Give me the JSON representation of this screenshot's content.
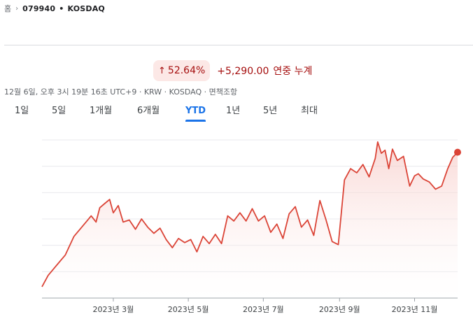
{
  "breadcrumb": {
    "home": "홈",
    "separator": "›",
    "symbol": "079940",
    "dot": "•",
    "exchange": "KOSDAQ"
  },
  "change": {
    "arrow": "↑",
    "percent": "52.64%",
    "absolute": "+5,290.00",
    "period": "연중 누계"
  },
  "meta": {
    "text": "12월 6일, 오후 3시 19분 16초 UTC+9 · KRW · KOSDAQ · 면책조항"
  },
  "tabs": [
    {
      "label": "1일",
      "active": false
    },
    {
      "label": "5일",
      "active": false
    },
    {
      "label": "1개월",
      "active": false
    },
    {
      "label": "6개월",
      "active": false
    },
    {
      "label": "YTD",
      "active": true
    },
    {
      "label": "1년",
      "active": false
    },
    {
      "label": "5년",
      "active": false
    },
    {
      "label": "최대",
      "active": false
    }
  ],
  "colors": {
    "line": "#db4437",
    "fill_top": "#f6c3bf",
    "grid": "#e8eaed",
    "accent": "#1a73e8",
    "up": "#a50e0e"
  },
  "chart_data": {
    "type": "area",
    "xlabel": "",
    "ylabel": "",
    "x_tick_labels": [
      "2023년 3월",
      "2023년 5월",
      "2023년 7월",
      "2023년 9월",
      "2023년 11월"
    ],
    "x_tick_dates": [
      "2023-03-01",
      "2023-05-01",
      "2023-07-01",
      "2023-09-01",
      "2023-11-01"
    ],
    "x_range": [
      "2023-01-02",
      "2023-12-06"
    ],
    "y_range": [
      9500,
      17200
    ],
    "y_gridlines": 6,
    "grid": true,
    "end_marker": true,
    "series": [
      {
        "x": [
          "2023-01-02",
          "2023-01-07",
          "2023-01-14",
          "2023-01-21",
          "2023-01-28",
          "2023-02-04",
          "2023-02-11",
          "2023-02-15",
          "2023-02-18",
          "2023-02-22",
          "2023-02-26",
          "2023-03-01",
          "2023-03-05",
          "2023-03-09",
          "2023-03-14",
          "2023-03-19",
          "2023-03-24",
          "2023-03-29",
          "2023-04-03",
          "2023-04-08",
          "2023-04-13",
          "2023-04-18",
          "2023-04-23",
          "2023-04-28",
          "2023-05-03",
          "2023-05-08",
          "2023-05-13",
          "2023-05-18",
          "2023-05-23",
          "2023-05-28",
          "2023-06-02",
          "2023-06-07",
          "2023-06-12",
          "2023-06-17",
          "2023-06-22",
          "2023-06-27",
          "2023-07-02",
          "2023-07-07",
          "2023-07-12",
          "2023-07-17",
          "2023-07-22",
          "2023-07-27",
          "2023-08-01",
          "2023-08-06",
          "2023-08-11",
          "2023-08-16",
          "2023-08-21",
          "2023-08-26",
          "2023-08-31",
          "2023-09-05",
          "2023-09-10",
          "2023-09-15",
          "2023-09-20",
          "2023-09-25",
          "2023-09-30",
          "2023-10-02",
          "2023-10-05",
          "2023-10-08",
          "2023-10-11",
          "2023-10-14",
          "2023-10-18",
          "2023-10-23",
          "2023-10-28",
          "2023-11-01",
          "2023-11-04",
          "2023-11-08",
          "2023-11-13",
          "2023-11-18",
          "2023-11-23",
          "2023-11-28",
          "2023-12-02",
          "2023-12-06"
        ],
        "y": [
          10050,
          10600,
          11100,
          11600,
          12500,
          13000,
          13500,
          13200,
          13900,
          14100,
          14300,
          13650,
          14000,
          13200,
          13300,
          12850,
          13350,
          12950,
          12650,
          12900,
          12350,
          11950,
          12400,
          12200,
          12350,
          11750,
          12500,
          12150,
          12600,
          12150,
          13500,
          13250,
          13650,
          13250,
          13850,
          13250,
          13500,
          12700,
          13100,
          12400,
          13600,
          13950,
          12950,
          13300,
          12550,
          14250,
          13300,
          12250,
          12100,
          15250,
          15800,
          15600,
          16000,
          15400,
          16300,
          17100,
          16550,
          16700,
          15800,
          16750,
          16200,
          16400,
          14950,
          15450,
          15550,
          15300,
          15150,
          14800,
          14950,
          15800,
          16350,
          16600
        ]
      }
    ]
  }
}
